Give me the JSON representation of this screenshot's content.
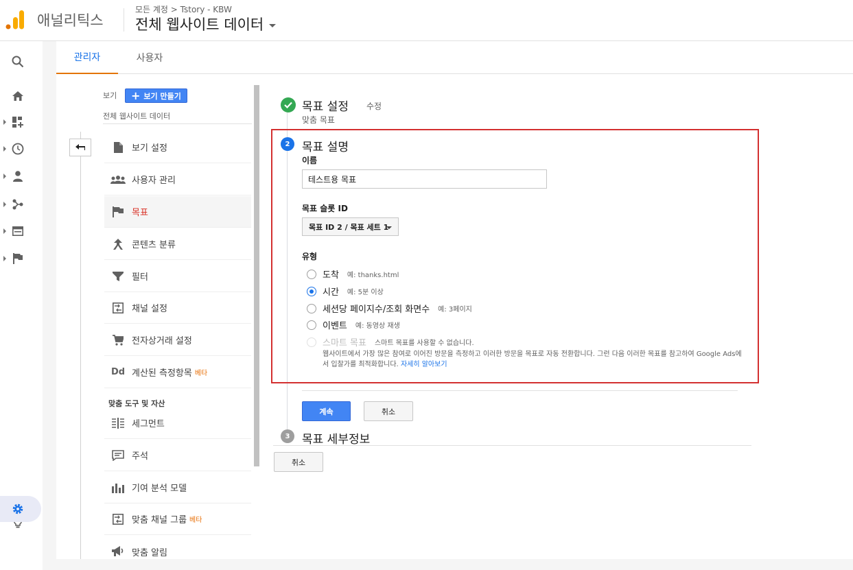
{
  "header": {
    "app_name": "애널리틱스",
    "breadcrumb": "모든 계정 > Tstory - KBW",
    "view_title": "전체 웹사이트 데이터"
  },
  "rail": {
    "icons": [
      "search-icon",
      "home-icon",
      "customization-icon",
      "realtime-icon",
      "audience-icon",
      "acquisition-icon",
      "behavior-icon",
      "conversions-icon",
      "lightbulb-icon",
      "admin-gear-icon"
    ]
  },
  "tabs": {
    "admin": "관리자",
    "user": "사용자"
  },
  "view_panel": {
    "label": "보기",
    "create_button": "보기 만들기",
    "view_name": "전체 웹사이트 데이터",
    "menu": [
      {
        "label": "보기 설정",
        "icon": "document-icon"
      },
      {
        "label": "사용자 관리",
        "icon": "people-icon"
      },
      {
        "label": "목표",
        "icon": "flag-icon"
      },
      {
        "label": "콘텐츠 분류",
        "icon": "content-grouping-icon"
      },
      {
        "label": "필터",
        "icon": "filter-icon"
      },
      {
        "label": "채널 설정",
        "icon": "channel-icon"
      },
      {
        "label": "전자상거래 설정",
        "icon": "cart-icon"
      },
      {
        "label": "계산된 측정항목",
        "icon": "dd-icon",
        "badge": "베타"
      }
    ],
    "tools_heading": "맞춤 도구 및 자산",
    "tools": [
      {
        "label": "세그먼트",
        "icon": "segments-icon"
      },
      {
        "label": "주석",
        "icon": "annotation-icon"
      },
      {
        "label": "기여 분석 모델",
        "icon": "attribution-icon"
      },
      {
        "label": "맞춤 채널 그룹",
        "icon": "channel-group-icon",
        "badge": "베타"
      },
      {
        "label": "맞춤 알림",
        "icon": "megaphone-icon"
      }
    ]
  },
  "goal": {
    "step1": {
      "number": "✓",
      "title": "목표 설정",
      "edit": "수정",
      "subtitle": "맞춤 목표"
    },
    "step2": {
      "number": "2",
      "title": "목표 설명",
      "name_label": "이름",
      "name_value": "테스트용 목표",
      "slot_label": "목표 슬롯 ID",
      "slot_value": "목표 ID 2 / 목표 세트 1",
      "type_label": "유형",
      "types": [
        {
          "label": "도착",
          "example": "예: thanks.html"
        },
        {
          "label": "시간",
          "example": "예: 5분 이상",
          "checked": true
        },
        {
          "label": "세션당 페이지수/조회 화면수",
          "example": "예: 3페이지"
        },
        {
          "label": "이벤트",
          "example": "예: 동영상 재생"
        },
        {
          "label": "스마트 목표",
          "example": "스마트 목표를 사용할 수 없습니다.",
          "disabled": true
        }
      ],
      "smart_description": "웹사이트에서 가장 많은 참여로 이어진 방문을 측정하고 이러한 방문을 목표로 자동 전환합니다. 그런 다음 이러한 목표를 참고하여 Google Ads에서 입찰가를 최적화합니다.",
      "learn_more": "자세히 알아보기",
      "continue_button": "계속",
      "cancel_button": "취소"
    },
    "step3": {
      "number": "3",
      "title": "목표 세부정보"
    },
    "cancel_button": "취소"
  },
  "colors": {
    "accent": "#1a73e8",
    "primary_button": "#4285f4",
    "success": "#34a853",
    "highlight_box": "#d32f2f",
    "active_menu": "#d93025",
    "beta": "#e8710a"
  }
}
